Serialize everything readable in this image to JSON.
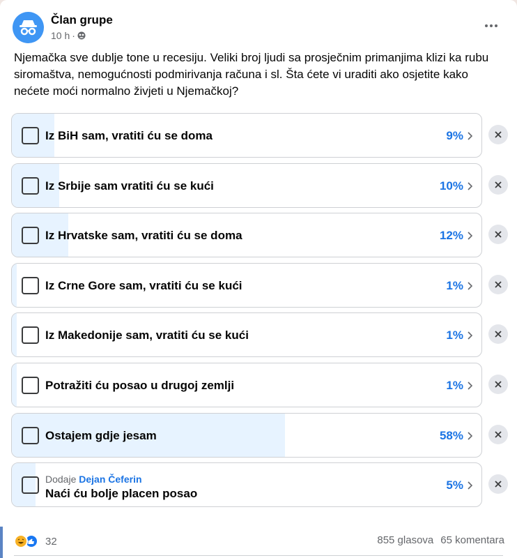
{
  "post": {
    "author": "Član grupe",
    "time": "10 h",
    "separator": "·",
    "text": "Njemačka sve dublje tone u recesiju. Veliki broj ljudi sa prosječnim primanjima klizi ka rubu siromaštva, nemogućnosti podmirivanja računa i sl. Šta ćete vi uraditi ako osjetite kako nećete moći normalno živjeti u Njemačkoj?"
  },
  "poll": {
    "options": [
      {
        "label": "Iz BiH sam, vratiti ću se doma",
        "percent_label": "9%",
        "percent": 9
      },
      {
        "label": "Iz Srbije sam vratiti ću se kući",
        "percent_label": "10%",
        "percent": 10
      },
      {
        "label": "Iz Hrvatske sam, vratiti ću se doma",
        "percent_label": "12%",
        "percent": 12
      },
      {
        "label": "Iz Crne Gore sam, vratiti ću se kući",
        "percent_label": "1%",
        "percent": 1
      },
      {
        "label": "Iz Makedonije sam, vratiti ću se kući",
        "percent_label": "1%",
        "percent": 1
      },
      {
        "label": "Potražiti ću posao u drugoj zemlji",
        "percent_label": "1%",
        "percent": 1
      },
      {
        "label": "Ostajem gdje jesam",
        "percent_label": "58%",
        "percent": 58
      }
    ],
    "added_option": {
      "added_by_prefix": "Dodaje",
      "added_by_name": "Dejan Čeferin",
      "label": "Naći ću bolje placen posao",
      "percent_label": "5%",
      "percent": 5
    }
  },
  "footer": {
    "reaction_icons": [
      "haha-icon",
      "like-icon"
    ],
    "reaction_count": "32",
    "votes": "855 glasova",
    "comments": "65 komentara"
  },
  "colors": {
    "accent": "#1b74e4",
    "fill": "#e7f3ff",
    "avatar": "#3f96f4"
  }
}
